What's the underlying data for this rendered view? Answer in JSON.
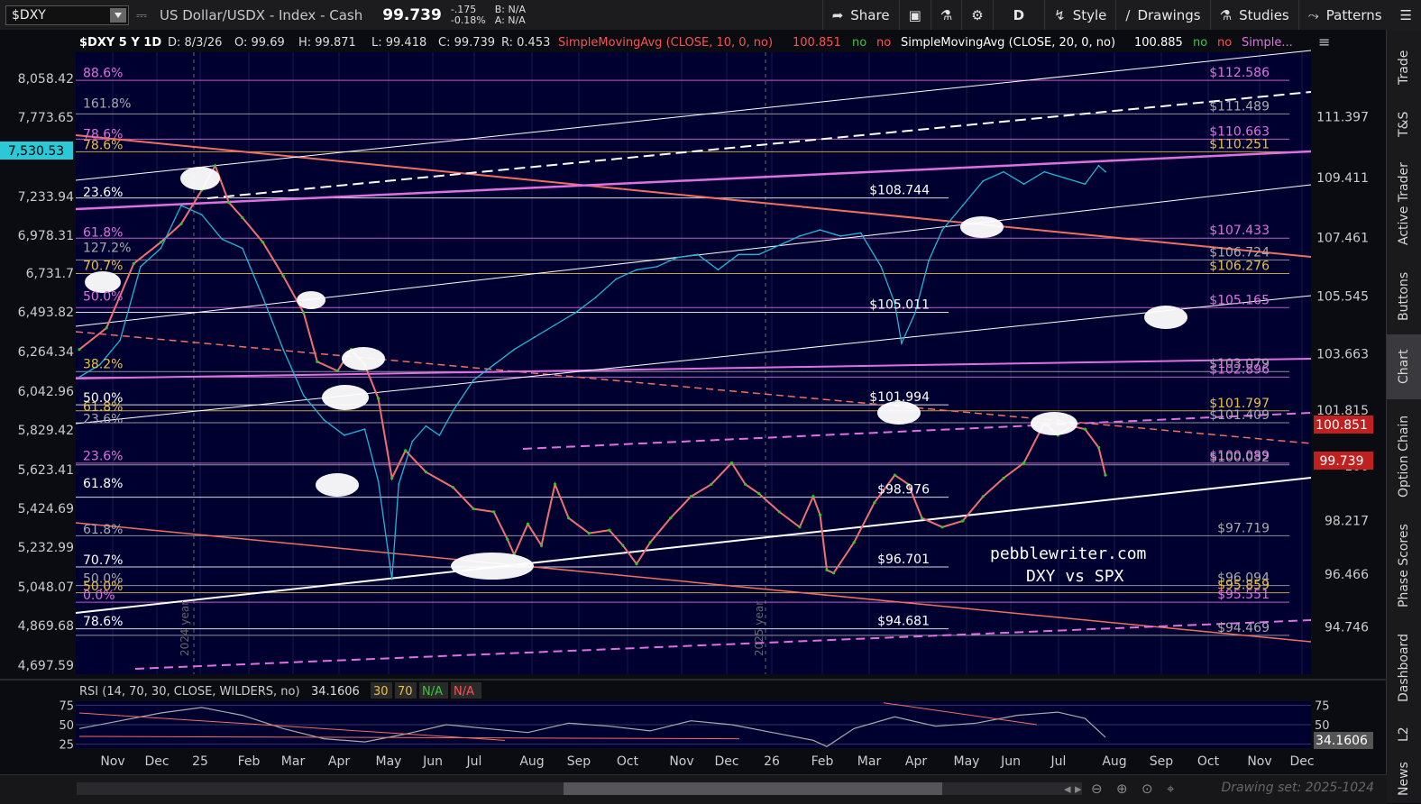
{
  "toolbar": {
    "symbol": "$DXY",
    "description": "US Dollar/USDX - Index - Cash",
    "last": "99.739",
    "change": "-.175",
    "change_pct": "-0.18%",
    "bid": "B: N/A",
    "ask": "A: N/A",
    "share": "Share",
    "interval": "D",
    "style": "Style",
    "drawings": "Drawings",
    "studies": "Studies",
    "patterns": "Patterns"
  },
  "sidebar": {
    "tabs": [
      "Trade",
      "T&S",
      "Active Trader",
      "Buttons",
      "Chart",
      "Option Chain",
      "Phase Scores",
      "Dashboard",
      "L2",
      "News"
    ],
    "active": "Chart"
  },
  "header": {
    "symbol_period": "$DXY 5 Y 1D",
    "date": "D: 8/3/26",
    "open": "O: 99.69",
    "high": "H: 99.871",
    "low": "L: 99.418",
    "close": "C: 99.739",
    "range": "R: 0.453",
    "sma10_label": "SimpleMovingAvg (CLOSE, 10, 0, no)",
    "sma10_value": "100.851",
    "sma20_label": "SimpleMovingAvg (CLOSE, 20, 0, no)",
    "sma20_value": "100.885",
    "no": "no",
    "simple_more": "Simple..."
  },
  "colors": {
    "background": "#000030",
    "price_candles_up": "#22cc22",
    "price_line": "#f07070",
    "spx_line": "#1fb6d6",
    "sma_pink": "#e070e0",
    "sma_red": "#f07060",
    "fib_white": "#ffffff",
    "fib_gold": "#e8c040",
    "fib_magenta": "#e050e0",
    "label_red": "#e03020"
  },
  "chart_data": [
    {
      "type": "line",
      "title": "$DXY 5 Y 1D",
      "x_ticks": [
        "Nov",
        "Dec",
        "25",
        "Feb",
        "Mar",
        "Apr",
        "May",
        "Jun",
        "Jul",
        "Aug",
        "Sep",
        "Oct",
        "Nov",
        "Dec",
        "26",
        "Feb",
        "Mar",
        "Apr",
        "May",
        "Jun",
        "Jul",
        "Aug",
        "Sep",
        "Oct",
        "Nov",
        "Dec"
      ],
      "year_markers": [
        "2024 year",
        "2025 year"
      ],
      "right_axis_ticks": [
        "111.397",
        "109.411",
        "107.461",
        "105.545",
        "103.663",
        "101.815",
        "100",
        "98.217",
        "96.466",
        "94.746"
      ],
      "right_axis_range": [
        93.2,
        113.5
      ],
      "left_axis_ticks": [
        "8,058.42",
        "7,773.65",
        "7,530.53",
        "7,233.94",
        "6,978.31",
        "6,731.7",
        "6,493.82",
        "6,264.34",
        "6,042.96",
        "5,829.42",
        "5,623.41",
        "5,424.69",
        "5,232.99",
        "5,048.07",
        "4,869.68",
        "4,697.59"
      ],
      "left_axis_highlight": "7,530.53",
      "price_badges": [
        {
          "text": "100.851",
          "color": "#e03020"
        },
        {
          "text": "99.739",
          "color": "#e03020"
        }
      ],
      "series": [
        {
          "name": "DXY",
          "values": [
            [
              0,
              103.8
            ],
            [
              4,
              104.5
            ],
            [
              8,
              106.6
            ],
            [
              12,
              107.3
            ],
            [
              15,
              107.9
            ],
            [
              18,
              109.0
            ],
            [
              20,
              109.8
            ],
            [
              22,
              108.6
            ],
            [
              24,
              108.1
            ],
            [
              27,
              107.3
            ],
            [
              30,
              106.2
            ],
            [
              33,
              105.0
            ],
            [
              35,
              103.4
            ],
            [
              38,
              103.1
            ],
            [
              40,
              103.8
            ],
            [
              42,
              103.3
            ],
            [
              44,
              102.2
            ],
            [
              46,
              99.6
            ],
            [
              48,
              100.5
            ],
            [
              51,
              99.8
            ],
            [
              55,
              99.3
            ],
            [
              58,
              98.6
            ],
            [
              61,
              98.5
            ],
            [
              63,
              97.6
            ],
            [
              64,
              97.1
            ],
            [
              66,
              98.1
            ],
            [
              68,
              97.4
            ],
            [
              70,
              99.4
            ],
            [
              72,
              98.3
            ],
            [
              75,
              97.8
            ],
            [
              78,
              97.9
            ],
            [
              80,
              97.4
            ],
            [
              82,
              96.8
            ],
            [
              84,
              97.5
            ],
            [
              87,
              98.3
            ],
            [
              90,
              99.0
            ],
            [
              93,
              99.4
            ],
            [
              96,
              100.1
            ],
            [
              98,
              99.4
            ],
            [
              100,
              99.1
            ],
            [
              103,
              98.5
            ],
            [
              106,
              98.0
            ],
            [
              108,
              99.0
            ],
            [
              109,
              98.4
            ],
            [
              110,
              96.6
            ],
            [
              111,
              96.5
            ],
            [
              114,
              97.5
            ],
            [
              117,
              98.8
            ],
            [
              120,
              99.7
            ],
            [
              122,
              99.4
            ],
            [
              124,
              98.3
            ],
            [
              127,
              98.0
            ],
            [
              130,
              98.2
            ],
            [
              133,
              99.0
            ],
            [
              136,
              99.6
            ],
            [
              139,
              100.1
            ],
            [
              142,
              101.4
            ],
            [
              144,
              101.0
            ],
            [
              146,
              101.3
            ],
            [
              148,
              101.2
            ],
            [
              150,
              100.6
            ],
            [
              151,
              99.7
            ]
          ]
        },
        {
          "name": "SPX",
          "values": [
            [
              0,
              102.9
            ],
            [
              3,
              103.3
            ],
            [
              6,
              104.1
            ],
            [
              9,
              106.5
            ],
            [
              12,
              107.1
            ],
            [
              15,
              108.5
            ],
            [
              18,
              108.2
            ],
            [
              21,
              107.4
            ],
            [
              24,
              107.1
            ],
            [
              27,
              105.5
            ],
            [
              30,
              103.8
            ],
            [
              33,
              102.3
            ],
            [
              36,
              101.5
            ],
            [
              39,
              101.0
            ],
            [
              42,
              101.2
            ],
            [
              44,
              99.5
            ],
            [
              46,
              96.3
            ],
            [
              47,
              99.4
            ],
            [
              49,
              100.8
            ],
            [
              51,
              101.3
            ],
            [
              53,
              101.0
            ],
            [
              55,
              101.8
            ],
            [
              58,
              102.8
            ],
            [
              61,
              103.3
            ],
            [
              64,
              103.8
            ],
            [
              67,
              104.2
            ],
            [
              70,
              104.6
            ],
            [
              73,
              105.0
            ],
            [
              76,
              105.5
            ],
            [
              79,
              106.1
            ],
            [
              82,
              106.4
            ],
            [
              85,
              106.5
            ],
            [
              88,
              106.8
            ],
            [
              91,
              106.9
            ],
            [
              94,
              106.4
            ],
            [
              97,
              106.9
            ],
            [
              100,
              106.9
            ],
            [
              103,
              107.2
            ],
            [
              106,
              107.5
            ],
            [
              109,
              107.7
            ],
            [
              112,
              107.5
            ],
            [
              115,
              107.6
            ],
            [
              118,
              106.5
            ],
            [
              120,
              105.3
            ],
            [
              121,
              104.0
            ],
            [
              123,
              105.0
            ],
            [
              125,
              106.7
            ],
            [
              127,
              107.7
            ],
            [
              130,
              108.5
            ],
            [
              133,
              109.3
            ],
            [
              136,
              109.6
            ],
            [
              139,
              109.2
            ],
            [
              142,
              109.6
            ],
            [
              145,
              109.4
            ],
            [
              148,
              109.2
            ],
            [
              150,
              109.8
            ],
            [
              151,
              109.6
            ]
          ]
        }
      ],
      "level_labels": [
        {
          "text": "88.6%",
          "color": "#e070e0",
          "side": "left",
          "value": 112.6
        },
        {
          "text": "161.8%",
          "color": "#aaaaaa",
          "side": "left",
          "value": 111.6
        },
        {
          "text": "78.6%",
          "color": "#e070e0",
          "side": "left",
          "value": 110.6
        },
        {
          "text": "78.6%",
          "color": "#e8c040",
          "side": "left",
          "value": 110.25
        },
        {
          "text": "23.6%",
          "color": "#ffffff",
          "side": "left",
          "value": 108.7
        },
        {
          "text": "61.8%",
          "color": "#e070e0",
          "side": "left",
          "value": 107.4
        },
        {
          "text": "127.2%",
          "color": "#aaaaaa",
          "side": "left",
          "value": 106.9
        },
        {
          "text": "70.7%",
          "color": "#e8c040",
          "side": "left",
          "value": 106.3
        },
        {
          "text": "50.0%",
          "color": "#e070e0",
          "side": "left",
          "value": 105.3
        },
        {
          "text": "38.2%",
          "color": "#e8c040",
          "side": "left",
          "value": 103.1
        },
        {
          "text": "50.0%",
          "color": "#ffffff",
          "side": "left",
          "value": 102.0
        },
        {
          "text": "61.8%",
          "color": "#e8c040",
          "side": "left",
          "value": 101.7
        },
        {
          "text": "23.6%",
          "color": "#aaaaaa",
          "side": "left",
          "value": 101.3
        },
        {
          "text": "23.6%",
          "color": "#e070e0",
          "side": "left",
          "value": 100.1
        },
        {
          "text": "61.8%",
          "color": "#ffffff",
          "side": "left",
          "value": 99.2
        },
        {
          "text": "61.8%",
          "color": "#aaaaaa",
          "side": "left",
          "value": 97.7
        },
        {
          "text": "70.7%",
          "color": "#ffffff",
          "side": "left",
          "value": 96.7
        },
        {
          "text": "50.0%",
          "color": "#aaaaaa",
          "side": "left",
          "value": 96.1
        },
        {
          "text": "50.0%",
          "color": "#e8c040",
          "side": "left",
          "value": 95.85
        },
        {
          "text": "0.0%",
          "color": "#e070e0",
          "side": "left",
          "value": 95.55
        },
        {
          "text": "78.6%",
          "color": "#ffffff",
          "side": "left",
          "value": 94.7
        },
        {
          "text": "$112.586",
          "color": "#e070e0",
          "side": "right",
          "value": 112.586
        },
        {
          "text": "$111.489",
          "color": "#aaaaaa",
          "side": "right",
          "value": 111.489
        },
        {
          "text": "$110.663",
          "color": "#e070e0",
          "side": "right",
          "value": 110.663
        },
        {
          "text": "$110.251",
          "color": "#e8c040",
          "side": "right",
          "value": 110.251
        },
        {
          "text": "$108.744",
          "color": "#ffffff",
          "side": "mid",
          "value": 108.744
        },
        {
          "text": "$107.433",
          "color": "#e070e0",
          "side": "right",
          "value": 107.433
        },
        {
          "text": "$106.724",
          "color": "#aaaaaa",
          "side": "right",
          "value": 106.724
        },
        {
          "text": "$106.276",
          "color": "#e8c040",
          "side": "right",
          "value": 106.276
        },
        {
          "text": "$105.011",
          "color": "#ffffff",
          "side": "mid",
          "value": 105.011
        },
        {
          "text": "$105.165",
          "color": "#e070e0",
          "side": "right",
          "value": 105.165
        },
        {
          "text": "$103.079",
          "color": "#aaaaaa",
          "side": "right",
          "value": 103.079
        },
        {
          "text": "$102.896",
          "color": "#e070e0",
          "side": "right",
          "value": 102.896
        },
        {
          "text": "$101.994",
          "color": "#ffffff",
          "side": "mid",
          "value": 101.994
        },
        {
          "text": "$101.797",
          "color": "#e8c040",
          "side": "right",
          "value": 101.797
        },
        {
          "text": "$101.409",
          "color": "#aaaaaa",
          "side": "right",
          "value": 101.409
        },
        {
          "text": "$100.089",
          "color": "#e070e0",
          "side": "right",
          "value": 100.089
        },
        {
          "text": "$100.032",
          "color": "#aaaaaa",
          "side": "right",
          "value": 100.032
        },
        {
          "text": "$98.976",
          "color": "#ffffff",
          "side": "mid",
          "value": 98.976
        },
        {
          "text": "$97.719",
          "color": "#aaaaaa",
          "side": "right",
          "value": 97.719
        },
        {
          "text": "$96.701",
          "color": "#ffffff",
          "side": "mid",
          "value": 96.701
        },
        {
          "text": "$96.094",
          "color": "#aaaaaa",
          "side": "right",
          "value": 96.094
        },
        {
          "text": "$95.859",
          "color": "#e8c040",
          "side": "right",
          "value": 95.859
        },
        {
          "text": "$95.551",
          "color": "#e070e0",
          "side": "right",
          "value": 95.551
        },
        {
          "text": "$94.681",
          "color": "#ffffff",
          "side": "mid",
          "value": 94.681
        },
        {
          "text": "$94.469",
          "color": "#aaaaaa",
          "side": "right",
          "value": 94.469
        }
      ],
      "annotations": [
        "pebblewriter.com",
        "DXY vs SPX"
      ]
    },
    {
      "type": "line",
      "title": "RSI (14, 70, 30, CLOSE, WILDERS, no)",
      "value_label": "34.1606",
      "levels": [
        "30",
        "70"
      ],
      "na_green": "N/A",
      "na_red": "N/A",
      "y_ticks": [
        "75",
        "50",
        "25"
      ],
      "ylim": [
        20,
        80
      ],
      "series": [
        {
          "name": "RSI",
          "values": [
            [
              0,
              45
            ],
            [
              6,
              55
            ],
            [
              12,
              65
            ],
            [
              18,
              72
            ],
            [
              24,
              62
            ],
            [
              30,
              45
            ],
            [
              36,
              32
            ],
            [
              42,
              28
            ],
            [
              48,
              38
            ],
            [
              54,
              50
            ],
            [
              60,
              45
            ],
            [
              66,
              40
            ],
            [
              72,
              52
            ],
            [
              78,
              48
            ],
            [
              84,
              42
            ],
            [
              90,
              55
            ],
            [
              96,
              50
            ],
            [
              102,
              40
            ],
            [
              108,
              30
            ],
            [
              110,
              22
            ],
            [
              114,
              45
            ],
            [
              120,
              60
            ],
            [
              126,
              48
            ],
            [
              132,
              52
            ],
            [
              138,
              62
            ],
            [
              144,
              66
            ],
            [
              148,
              58
            ],
            [
              151,
              34
            ]
          ]
        }
      ]
    }
  ],
  "bottom": {
    "drawing_set": "Drawing set: 2025-1024"
  }
}
